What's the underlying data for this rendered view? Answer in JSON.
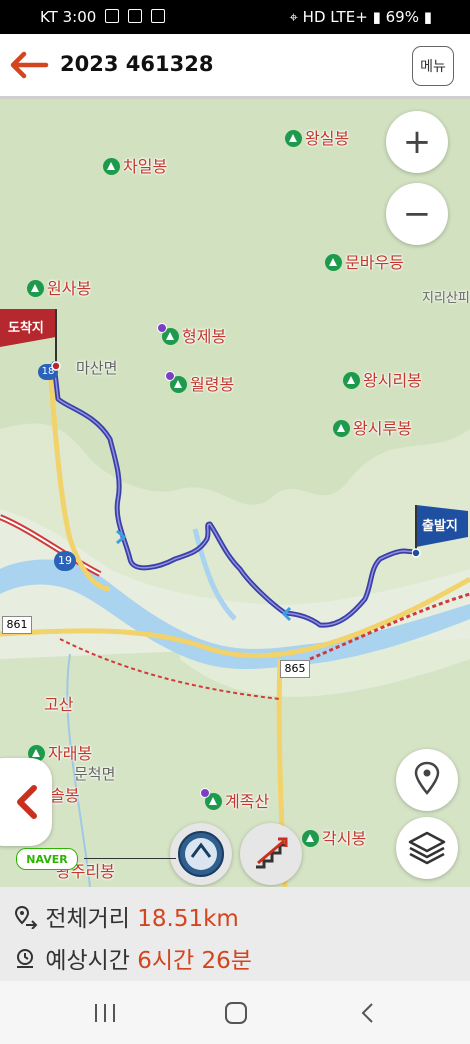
{
  "status_bar": {
    "carrier": "KT",
    "time": "3:00",
    "network": "HD LTE+",
    "battery": "69%"
  },
  "header": {
    "title": "2023 461328",
    "menu_label": "메뉴"
  },
  "map": {
    "peaks": [
      {
        "name": "왕실봉"
      },
      {
        "name": "차일봉"
      },
      {
        "name": "문바우등"
      },
      {
        "name": "원사봉"
      },
      {
        "name": "형제봉"
      },
      {
        "name": "월령봉"
      },
      {
        "name": "왕시리봉"
      },
      {
        "name": "왕시루봉"
      },
      {
        "name": "자래봉"
      },
      {
        "name": "솔봉"
      },
      {
        "name": "계족산"
      },
      {
        "name": "각시봉"
      },
      {
        "name": "왕주리봉"
      }
    ],
    "places": {
      "masan": "마산면",
      "munchuk": "문척면",
      "jirisan": "지리산피",
      "gosan": "고산"
    },
    "roads": {
      "r19a": "18",
      "r19b": "19",
      "r861": "861",
      "r865": "865"
    },
    "markers": {
      "end_label": "도착지",
      "start_label": "출발지"
    },
    "attribution": "NAVER",
    "colors": {
      "route": "#3b3fa8",
      "accent": "#d2451e",
      "peak_pin": "#1e9a4c"
    }
  },
  "summary": {
    "distance_label": "전체거리",
    "distance_value": "18.51km",
    "time_label": "예상시간",
    "time_value": "6시간 26분"
  },
  "icons": [
    "back-arrow-icon",
    "zoom-in-icon",
    "zoom-out-icon",
    "location-pin-icon",
    "layers-icon",
    "compass-icon",
    "elevation-icon",
    "chevron-left-icon",
    "distance-icon",
    "clock-icon"
  ]
}
